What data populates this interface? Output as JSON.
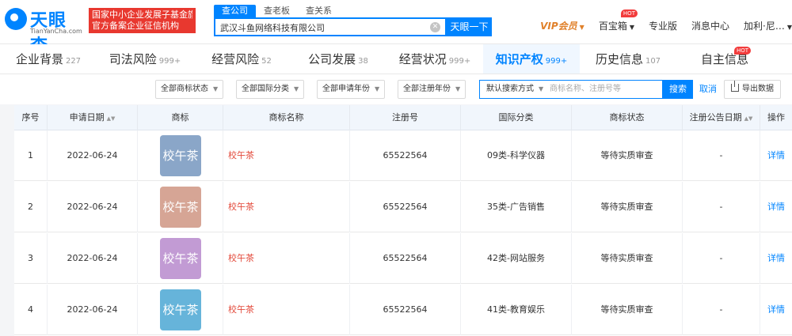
{
  "header": {
    "logo_text": "天眼查",
    "logo_sub": "TianYanCha.com",
    "slogan_line1": "国家中小企业发展子基金旗下",
    "slogan_line2": "官方备案企业征信机构",
    "search_tabs": [
      "查公司",
      "查老板",
      "查关系"
    ],
    "search_value": "武汉斗鱼网络科技有限公司",
    "search_button": "天眼一下",
    "nav": {
      "vip": "VIP会员",
      "treasure": "百宝箱",
      "pro": "专业版",
      "messages": "消息中心",
      "user": "加利·尼…",
      "hot": "HOT"
    }
  },
  "tabs": [
    {
      "label": "企业背景",
      "count": "227"
    },
    {
      "label": "司法风险",
      "count": "999+"
    },
    {
      "label": "经营风险",
      "count": "52"
    },
    {
      "label": "公司发展",
      "count": "38"
    },
    {
      "label": "经营状况",
      "count": "999+"
    },
    {
      "label": "知识产权",
      "count": "999+"
    },
    {
      "label": "历史信息",
      "count": "107"
    },
    {
      "label": "自主信息",
      "count": ""
    }
  ],
  "filters": {
    "status": "全部商标状态",
    "intl_class": "全部国际分类",
    "apply_year": "全部申请年份",
    "reg_year": "全部注册年份",
    "search_mode": "默认搜索方式",
    "input_placeholder": "商标名称、注册号等",
    "search": "搜索",
    "cancel": "取消",
    "export": "导出数据"
  },
  "table": {
    "headers": [
      "序号",
      "申请日期",
      "商标",
      "商标名称",
      "注册号",
      "国际分类",
      "商标状态",
      "注册公告日期",
      "操作"
    ],
    "rows": [
      {
        "no": "1",
        "date": "2022-06-24",
        "image_text": "校午茶",
        "image_color": "#8aa6c8",
        "name": "校午茶",
        "reg_no": "65522564",
        "class": "09类-科学仪器",
        "status": "等待实质审查",
        "pub_date": "-",
        "action": "详情"
      },
      {
        "no": "2",
        "date": "2022-06-24",
        "image_text": "校午茶",
        "image_color": "#d6a595",
        "name": "校午茶",
        "reg_no": "65522564",
        "class": "35类-广告销售",
        "status": "等待实质审查",
        "pub_date": "-",
        "action": "详情"
      },
      {
        "no": "3",
        "date": "2022-06-24",
        "image_text": "校午茶",
        "image_color": "#c29bd4",
        "name": "校午茶",
        "reg_no": "65522564",
        "class": "42类-网站服务",
        "status": "等待实质审查",
        "pub_date": "-",
        "action": "详情"
      },
      {
        "no": "4",
        "date": "2022-06-24",
        "image_text": "校午茶",
        "image_color": "#66b4da",
        "name": "校午茶",
        "reg_no": "65522564",
        "class": "41类-教育娱乐",
        "status": "等待实质审查",
        "pub_date": "-",
        "action": "详情"
      }
    ]
  }
}
